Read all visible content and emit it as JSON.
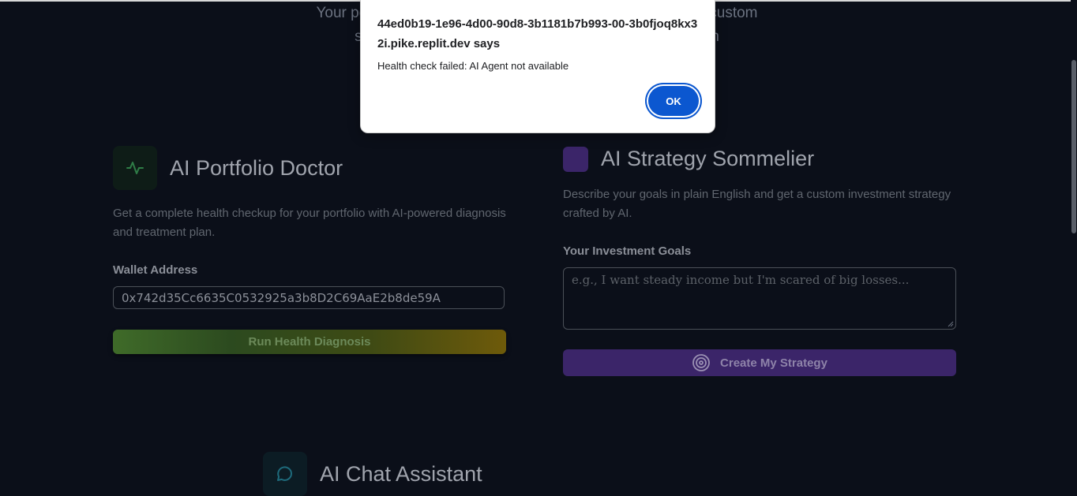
{
  "hero": {
    "line1": "Your personal AI investment advisor that analyzes, creates custom",
    "line2": "strategies, and answers your questions, saving Warren"
  },
  "portfolio_doctor": {
    "title": "AI Portfolio Doctor",
    "icon": "activity-pulse-icon",
    "description": "Get a complete health checkup for your portfolio with AI-powered diagnosis and treatment plan.",
    "wallet_label": "Wallet Address",
    "wallet_value": "0x742d35Cc6635C0532925a3b8D2C69AaE2b8de59A",
    "button_label": "Run Health Diagnosis",
    "accent": "#4ade80"
  },
  "strategy_sommelier": {
    "title": "AI Strategy Sommelier",
    "description": "Describe your goals in plain English and get a custom investment strategy crafted by AI.",
    "goals_label": "Your Investment Goals",
    "goals_placeholder": "e.g., I want steady income but I'm scared of big losses...",
    "button_label": "Create My Strategy",
    "button_icon": "target-icon",
    "accent": "#7c3aed"
  },
  "chat_assistant": {
    "title": "AI Chat Assistant",
    "icon": "chat-bubble-icon",
    "accent": "#06b6d4"
  },
  "alert_dialog": {
    "title": "44ed0b19-1e96-4d00-90d8-3b1181b7b993-00-3b0fjoq8kx32i.pike.replit.dev says",
    "message": "Health check failed: AI Agent not available",
    "ok_label": "OK"
  }
}
